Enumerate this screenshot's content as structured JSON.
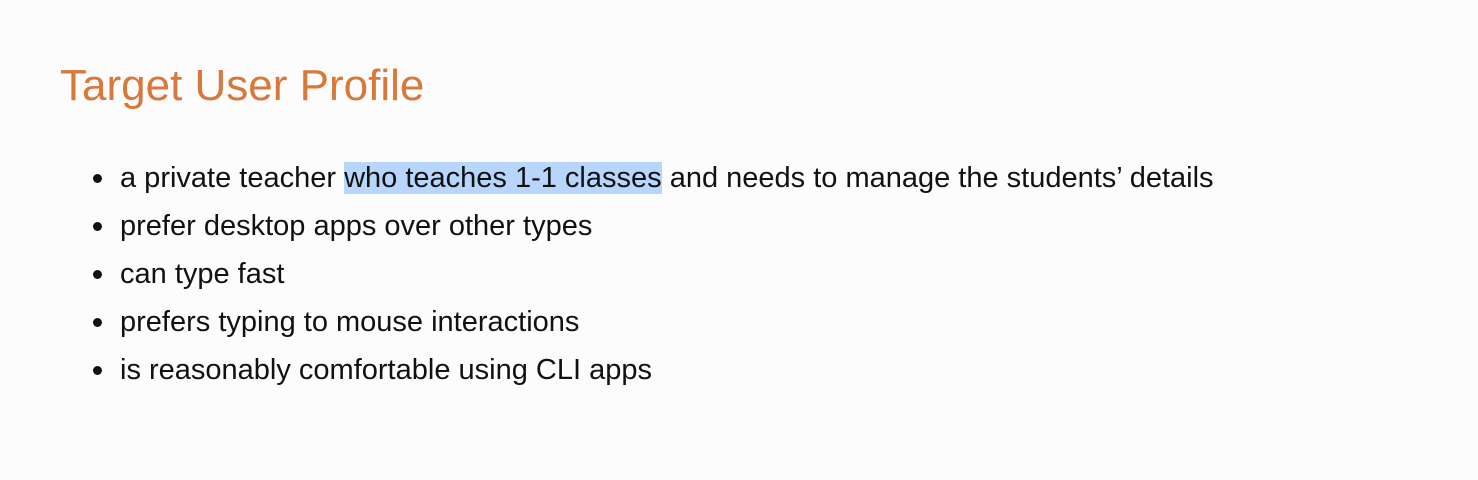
{
  "heading": {
    "title": "Target User Profile"
  },
  "colors": {
    "heading": "#d8783a",
    "selection_highlight": "#b8d6fb",
    "text": "#111111",
    "background": "#fcfcfc"
  },
  "profile_items": [
    {
      "before": "a private teacher ",
      "selected": "who teaches 1-1 classes",
      "after": " and needs to manage the students’ details"
    },
    {
      "text": "prefer desktop apps over other types"
    },
    {
      "text": "can type fast"
    },
    {
      "text": "prefers typing to mouse interactions"
    },
    {
      "text": "is reasonably comfortable using CLI apps"
    }
  ]
}
